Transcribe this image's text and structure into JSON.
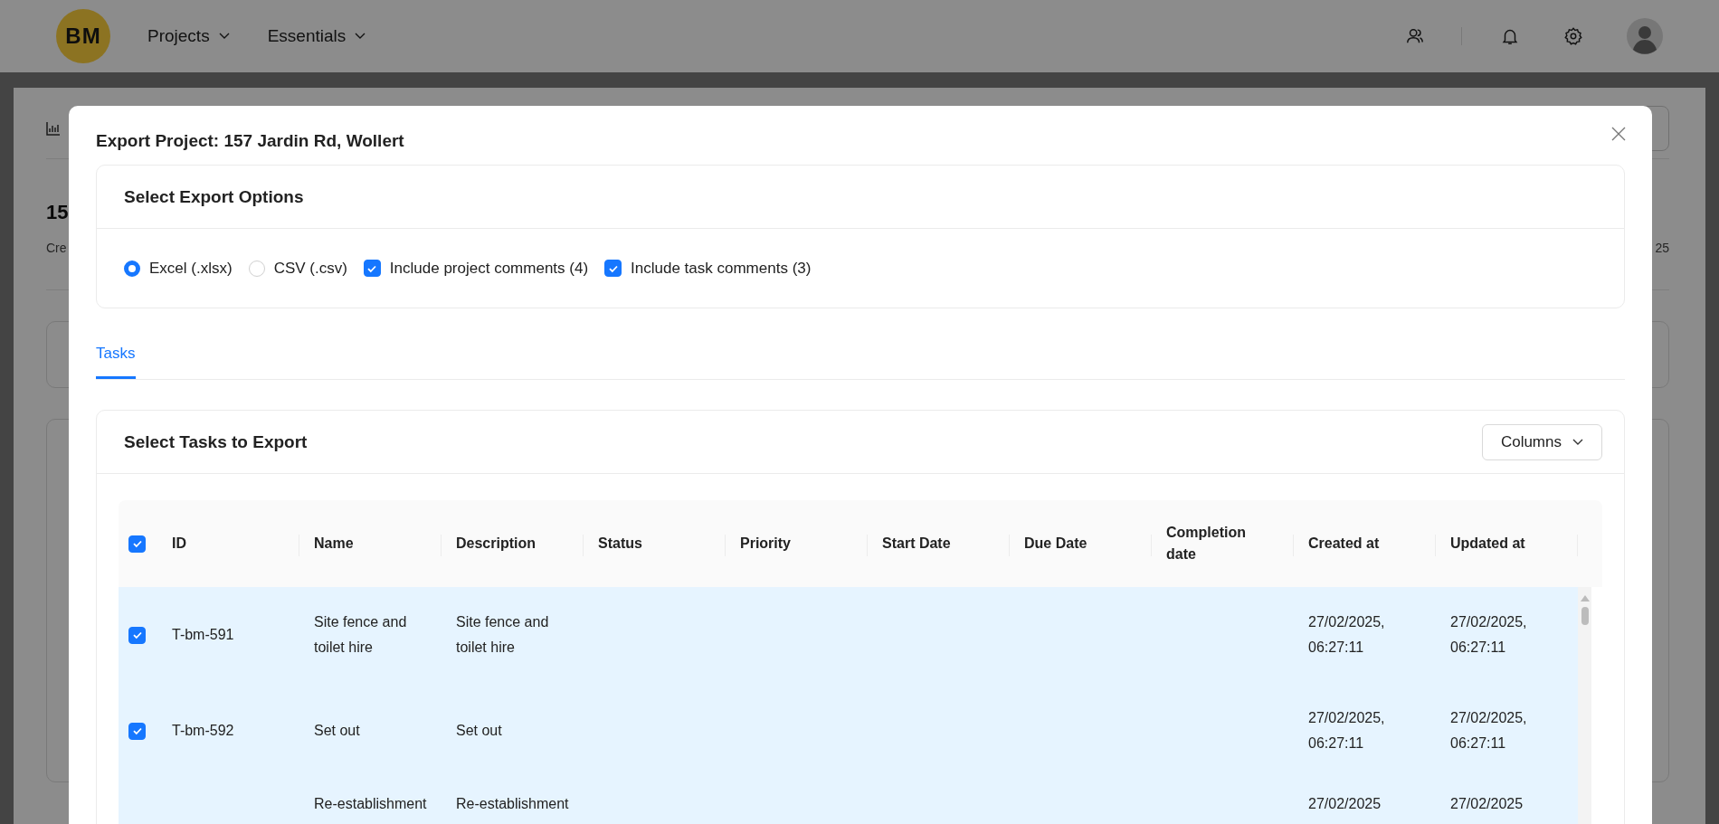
{
  "header": {
    "logo": "BM",
    "nav": [
      {
        "label": "Projects"
      },
      {
        "label": "Essentials"
      }
    ]
  },
  "background": {
    "title": "15",
    "subtitle": "Cre",
    "date": "25"
  },
  "modal": {
    "title": "Export Project: 157 Jardin Rd, Wollert",
    "options_card": {
      "title": "Select Export Options",
      "options": [
        {
          "kind": "radio",
          "label": "Excel (.xlsx)",
          "selected": true
        },
        {
          "kind": "radio",
          "label": "CSV (.csv)",
          "selected": false
        },
        {
          "kind": "checkbox",
          "label": "Include project comments (4)",
          "checked": true
        },
        {
          "kind": "checkbox",
          "label": "Include task comments (3)",
          "checked": true
        }
      ]
    },
    "tabs": [
      {
        "label": "Tasks",
        "selected": true
      }
    ],
    "tasks_card": {
      "title": "Select Tasks to Export",
      "columns_button": "Columns",
      "table": {
        "all_checked": true,
        "columns": [
          "ID",
          "Name",
          "Description",
          "Status",
          "Priority",
          "Start Date",
          "Due Date",
          "Completion date",
          "Created at",
          "Updated at"
        ],
        "rows": [
          {
            "selected": true,
            "id": "T-bm-591",
            "name": "Site fence and toilet hire",
            "description": "Site fence and toilet hire",
            "created_at": "27/02/2025, 06:27:11",
            "updated_at": "27/02/2025, 06:27:11"
          },
          {
            "selected": true,
            "id": "T-bm-592",
            "name": "Set out",
            "description": "Set out",
            "created_at": "27/02/2025, 06:27:11",
            "updated_at": "27/02/2025, 06:27:11"
          },
          {
            "selected": true,
            "name": "Re-establishment",
            "description": "Re-establishment",
            "created_at": "27/02/2025",
            "updated_at": "27/02/2025"
          }
        ]
      }
    }
  }
}
